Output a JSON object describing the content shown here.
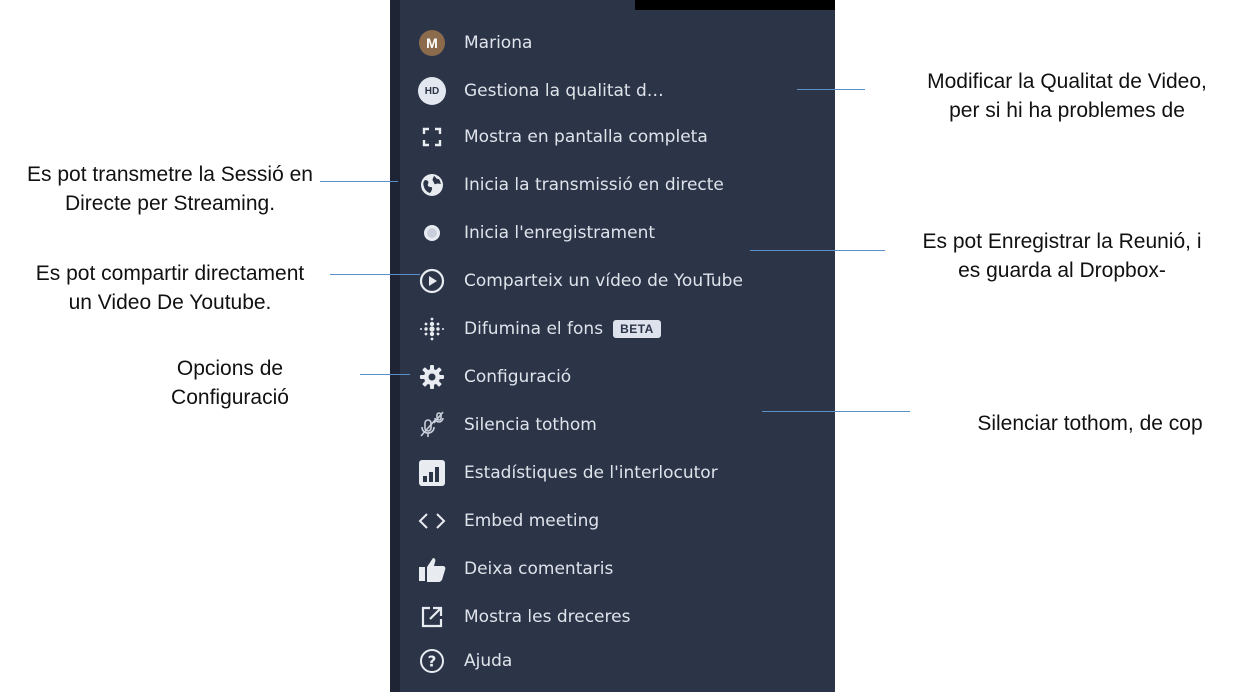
{
  "menu": {
    "items": [
      {
        "icon": "avatar-icon",
        "icon_text": "M",
        "label": "Mariona"
      },
      {
        "icon": "hd-icon",
        "icon_text": "HD",
        "label": "Gestiona la qualitat d…"
      },
      {
        "icon": "fullscreen-icon",
        "label": "Mostra en pantalla completa"
      },
      {
        "icon": "globe-icon",
        "label": "Inicia la transmissió en directe"
      },
      {
        "icon": "record-icon",
        "label": "Inicia l'enregistrament"
      },
      {
        "icon": "play-circle-icon",
        "label": "Comparteix un vídeo de YouTube"
      },
      {
        "icon": "blur-icon",
        "label": "Difumina el fons",
        "badge": "BETA"
      },
      {
        "icon": "gear-icon",
        "label": "Configuració"
      },
      {
        "icon": "mute-all-icon",
        "label": "Silencia tothom"
      },
      {
        "icon": "stats-icon",
        "label": "Estadístiques de l'interlocutor"
      },
      {
        "icon": "embed-code-icon",
        "label": "Embed meeting"
      },
      {
        "icon": "thumbs-up-icon",
        "label": "Deixa comentaris"
      },
      {
        "icon": "external-link-icon",
        "label": "Mostra les dreceres"
      },
      {
        "icon": "help-icon",
        "label": "Ajuda"
      }
    ]
  },
  "annotations": {
    "quality": [
      "Modificar la Qualitat de Video,",
      "per si hi ha problemes de"
    ],
    "streaming": [
      "Es pot transmetre la Sessió en",
      "Directe per Streaming."
    ],
    "recording": [
      "Es pot Enregistrar la Reunió, i",
      "es guarda al Dropbox-"
    ],
    "youtube": [
      "Es pot compartir directament",
      "un Video De Youtube."
    ],
    "settings": [
      "Opcions de",
      "Configuració"
    ],
    "mute": [
      "Silenciar tothom, de cop"
    ]
  },
  "colors": {
    "menu_bg": "#2c3448",
    "menu_text": "#dfe3ea",
    "line": "#5b8fc7",
    "avatar": "#8b6b4b"
  }
}
